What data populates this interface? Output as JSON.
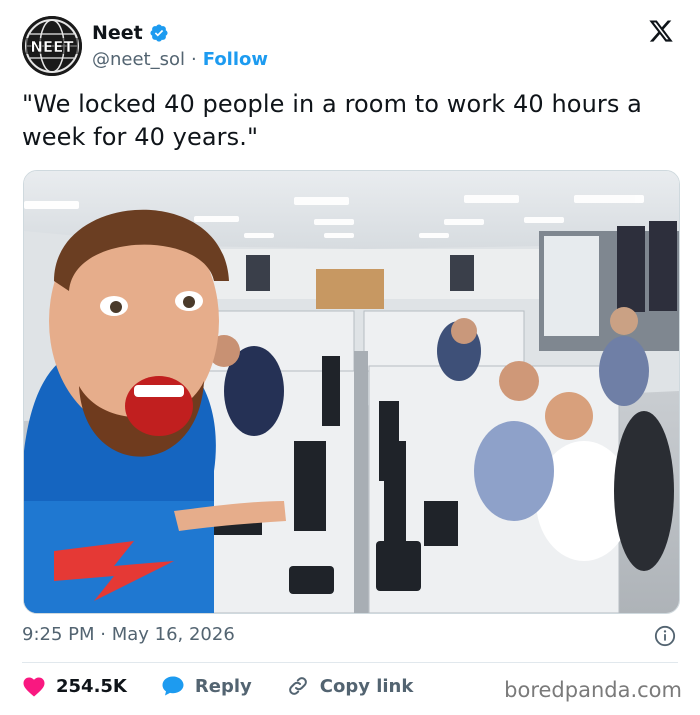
{
  "post": {
    "author": {
      "name": "Neet",
      "handle": "@neet_sol",
      "separator": "·",
      "follow_label": "Follow",
      "avatar_text": "NEET"
    },
    "text": "\"We locked 40 people in a room to work 40 hours a week for 40 years.\"",
    "timestamp": "9:25 PM · May 16, 2026",
    "actions": {
      "likes": "254.5K",
      "reply_label": "Reply",
      "copy_label": "Copy link"
    }
  },
  "icons": {
    "verified": "verified-badge-icon",
    "x": "x-logo-icon",
    "info": "info-icon",
    "heart": "heart-icon",
    "reply": "reply-bubble-icon",
    "link": "link-icon"
  },
  "watermark": "boredpanda.com",
  "colors": {
    "accent": "#1d9bf0",
    "like": "#f91880",
    "muted": "#536471",
    "text": "#0f1419"
  }
}
